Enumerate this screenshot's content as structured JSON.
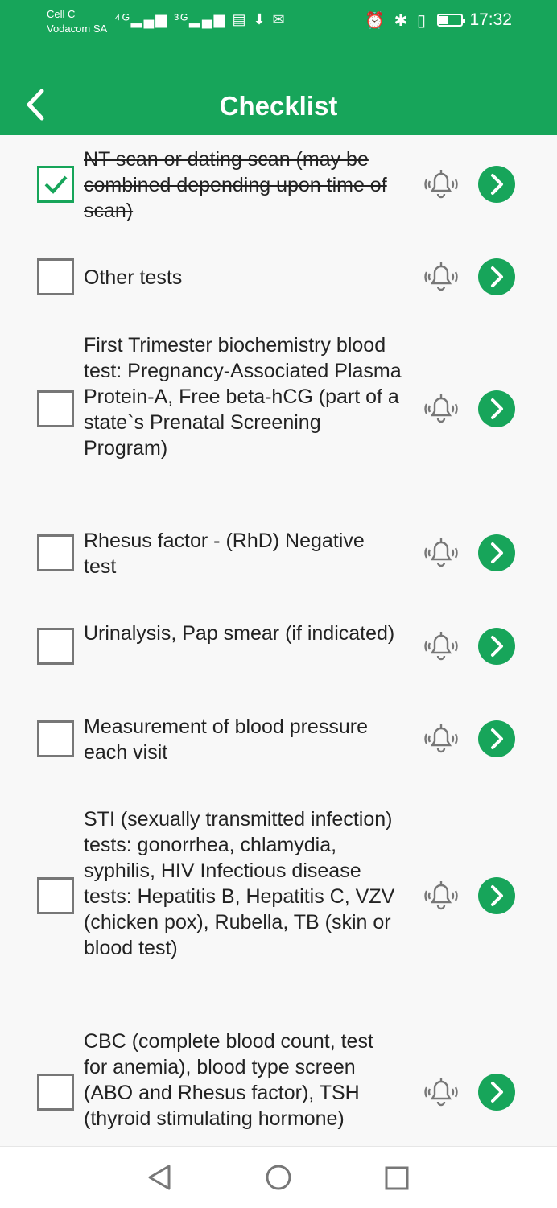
{
  "status_bar": {
    "carrier_line1": "Cell C",
    "carrier_line2": "Vodacom SA",
    "left_icons": "⁴ᴳ▂▄▆ ³ᴳ▂▄▆ ▤ ⬇ ✉",
    "right_icons": "⏰ ✱ ▯",
    "time": "17:32",
    "icons": [
      "signal-4g-icon",
      "signal-3g-icon",
      "news-icon",
      "download-icon",
      "mail-icon",
      "alarm-icon",
      "bluetooth-icon",
      "vibrate-icon",
      "battery-icon"
    ]
  },
  "header": {
    "title": "Checklist",
    "back_icon": "chevron-left-icon"
  },
  "colors": {
    "primary": "#17a55a",
    "checkbox_border": "#777777",
    "text": "#222222"
  },
  "checklist": [
    {
      "label": "NT scan or dating scan (may be combined depending upon time of scan)",
      "checked": true
    },
    {
      "label": "Other tests",
      "checked": false
    },
    {
      "label": "First Trimester biochemistry blood test: Pregnancy-Associated Plasma Protein-A, Free beta-hCG (part of a state`s Prenatal Screening Program)",
      "checked": false
    },
    {
      "label": "Rhesus factor - (RhD) Negative test",
      "checked": false
    },
    {
      "label": "Urinalysis, Pap smear (if indicated)",
      "checked": false
    },
    {
      "label": "Measurement of blood pressure each visit",
      "checked": false
    },
    {
      "label": "STI (sexually transmitted infection) tests: gonorrhea, chlamydia, syphilis, HIV Infectious disease tests: Hepatitis B, Hepatitis C, VZV (chicken pox), Rubella, TB (skin or blood test)",
      "checked": false
    },
    {
      "label": "CBC (complete blood count, test for anemia), blood type screen (ABO and Rhesus factor), TSH (thyroid stimulating hormone)",
      "checked": false
    }
  ],
  "item_icons": {
    "reminder": "bell-ringing-icon",
    "open": "chevron-right-circle-icon"
  },
  "nav": {
    "icons": [
      "nav-back-icon",
      "nav-home-icon",
      "nav-recents-icon"
    ]
  }
}
